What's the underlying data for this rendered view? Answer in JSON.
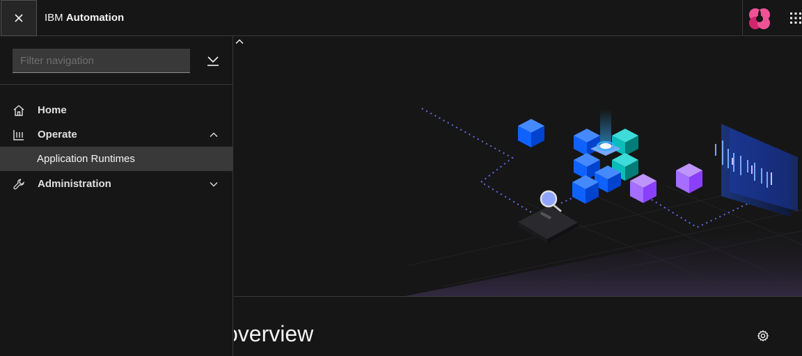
{
  "header": {
    "brand_prefix": "IBM",
    "brand_name": "Automation",
    "close_icon": "close-icon",
    "avatar_icon": "user-avatar-icon",
    "switcher_icon": "app-switcher-icon"
  },
  "sidenav": {
    "filter": {
      "placeholder": "Filter navigation",
      "value": ""
    },
    "collapse_icon": "collapse-all-icon",
    "items": [
      {
        "label": "Home",
        "icon": "home-icon"
      },
      {
        "label": "Operate",
        "icon": "dashboard-icon",
        "expanded": true,
        "children": [
          {
            "label": "Application Runtimes",
            "selected": true
          }
        ]
      },
      {
        "label": "Administration",
        "icon": "wrench-icon",
        "expanded": false
      }
    ]
  },
  "main": {
    "title_visible": "overview",
    "settings_icon": "settings-icon",
    "hero_collapse_icon": "chevron-up-icon"
  },
  "colors": {
    "background": "#161616",
    "border": "#393939",
    "selected": "#393939",
    "blue": "#0f62fe",
    "teal": "#1192e8",
    "purple": "#a56eff"
  }
}
